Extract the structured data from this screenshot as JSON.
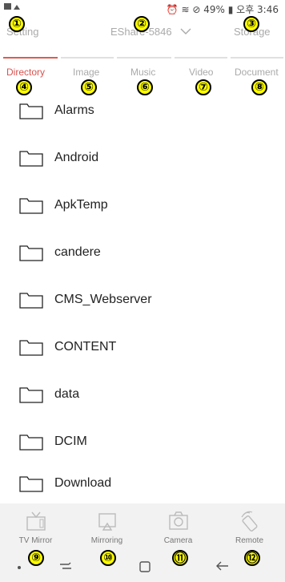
{
  "status": {
    "battery": "49%",
    "time": "오후 3:46"
  },
  "header": {
    "setting_label": "Setting",
    "device_label": "EShare-5846",
    "storage_label": "Storage"
  },
  "tabs": [
    {
      "label": "Directory",
      "active": true
    },
    {
      "label": "Image",
      "active": false
    },
    {
      "label": "Music",
      "active": false
    },
    {
      "label": "Video",
      "active": false
    },
    {
      "label": "Document",
      "active": false
    }
  ],
  "folders": [
    "Alarms",
    "Android",
    "ApkTemp",
    "candere",
    "CMS_Webserver",
    "CONTENT",
    "data",
    "DCIM",
    "Download"
  ],
  "bottom_nav": [
    {
      "label": "TV Mirror",
      "icon": "tv-icon"
    },
    {
      "label": "Mirroring",
      "icon": "mirroring-icon"
    },
    {
      "label": "Camera",
      "icon": "camera-icon"
    },
    {
      "label": "Remote",
      "icon": "remote-icon"
    }
  ],
  "markers": [
    "①",
    "②",
    "③",
    "④",
    "⑤",
    "⑥",
    "⑦",
    "⑧",
    "⑨",
    "⑩",
    "⑪",
    "⑫"
  ],
  "colors": {
    "accent": "#e05a4f",
    "marker": "#ffff00"
  }
}
